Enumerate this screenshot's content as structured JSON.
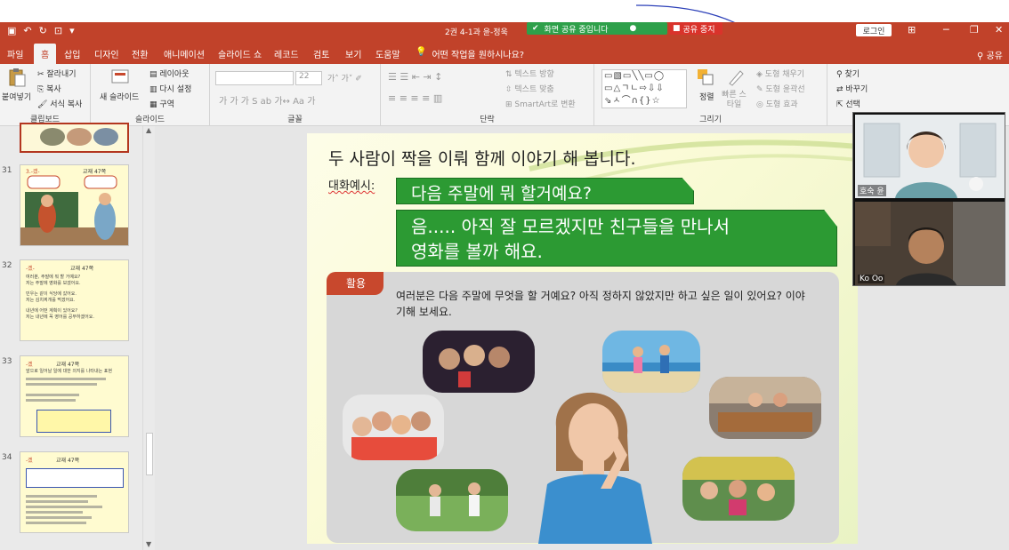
{
  "app": {
    "document_title": "2권 4-1과 윤-정욱",
    "share_banner": "화면 공유 중입니다",
    "stop_share": "공유 중지",
    "login": "로그인"
  },
  "menu": {
    "tabs": [
      "파일",
      "홈",
      "삽입",
      "디자인",
      "전환",
      "애니메이션",
      "슬라이드 쇼",
      "레코드",
      "검토",
      "보기",
      "도움말"
    ],
    "active_tab": "홈",
    "tell_me": "어떤 작업을 원하시나요?",
    "share": "공유"
  },
  "ribbon": {
    "clipboard": {
      "label": "클립보드",
      "paste": "붙여넣기",
      "cut": "잘라내기",
      "copy": "복사",
      "format_painter": "서식 복사"
    },
    "slides": {
      "label": "슬라이드",
      "new_slide": "새 슬라이드",
      "layout": "레이아웃",
      "reset": "다시 설정",
      "section": "구역"
    },
    "font": {
      "label": "글꼴",
      "size": "22"
    },
    "paragraph": {
      "label": "단락",
      "text_direction": "텍스트 방향",
      "align_text": "텍스트 맞춤",
      "smartart": "SmartArt로 변환"
    },
    "drawing": {
      "label": "그리기",
      "arrange": "정렬",
      "quick_styles": "빠른 스타일",
      "shape_fill": "도형 채우기",
      "shape_outline": "도형 윤곽선",
      "shape_effects": "도형 효과"
    },
    "editing": {
      "find": "찾기",
      "replace": "바꾸기",
      "select": "선택"
    }
  },
  "thumbnails": [
    {
      "num": "31",
      "caption": "교재 47쪽",
      "title": "3.-겠-"
    },
    {
      "num": "32",
      "caption": "교재 47쪽",
      "title": "-겠-",
      "lines": [
        "여러분, 주말에 뭐 할 거예요?",
        "저는 주말에 영화를 보겠어요.",
        "민우는 같이 식당에 갔어요.",
        "저는 김치찌개를 먹겠어요.",
        "내년에 어떤 계획이 있어요?",
        "저는 내년에 꼭 영어를 공부하겠어요."
      ]
    },
    {
      "num": "33",
      "caption": "교재 47쪽",
      "title": "-겠",
      "lines": [
        "앞으로 일어날 일에 대한 의지를 나타내는 표현"
      ]
    },
    {
      "num": "34",
      "caption": "교재 47쪽",
      "title": "-겠"
    }
  ],
  "slide": {
    "heading": "두 사람이 짝을 이뤄 함께 이야기 해 봅니다.",
    "dialog_label": "대화예시:",
    "bubble1": "다음 주말에 뭐 할거예요?",
    "bubble2_line1": "음..... 아직 잘 모르겠지만 친구들을 만나서",
    "bubble2_line2": "영화를 볼까 해요.",
    "panel_tag": "활용",
    "panel_text": "여러분은 다음 주말에 무엇을 할 거예요? 아직 정하지 않았지만 하고 싶은 일이 있어요? 이야기해 보세요."
  },
  "webcams": [
    {
      "name": "호숙 윤"
    },
    {
      "name": "Ko Oo"
    }
  ],
  "colors": {
    "accent": "#c1422a",
    "bubble_green": "#2c9a33",
    "tag_red": "#c8482d",
    "share_green": "#2ea04a",
    "stop_red": "#d9332b"
  }
}
